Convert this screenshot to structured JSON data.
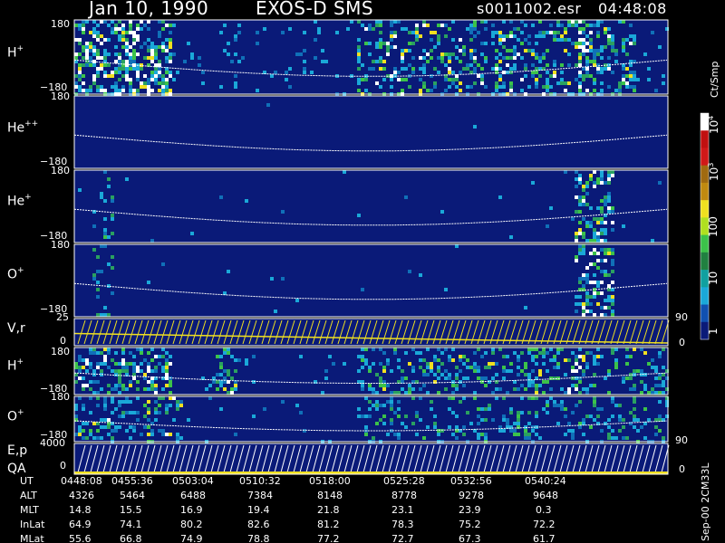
{
  "header": {
    "date": "Jan 10, 1990",
    "instrument": "EXOS-D SMS",
    "file": "s0011002.esr",
    "time": "04:48:08"
  },
  "panels": [
    {
      "label": "H",
      "charge": "+",
      "top_tick": "180",
      "bottom_tick": "−180"
    },
    {
      "label": "He",
      "charge": "++",
      "top_tick": "180",
      "bottom_tick": "−180"
    },
    {
      "label": "He",
      "charge": "+",
      "top_tick": "180",
      "bottom_tick": "−180"
    },
    {
      "label": "O",
      "charge": "+",
      "top_tick": "180",
      "bottom_tick": "−180"
    },
    {
      "label": "V,r",
      "charge": "",
      "top_tick": "25",
      "bottom_tick": "0",
      "right_top": "90",
      "right_bottom": "0"
    },
    {
      "label": "H",
      "charge": "+",
      "top_tick": "180",
      "bottom_tick": "−180"
    },
    {
      "label": "O",
      "charge": "+",
      "top_tick": "180",
      "bottom_tick": "−180"
    },
    {
      "label": "E,p",
      "label2": "QA",
      "charge": "",
      "top_tick": "4000",
      "bottom_tick": "0",
      "right_top": "90",
      "right_bottom": "0"
    }
  ],
  "colorbar": {
    "unit": "Ct/Smp",
    "ticks": [
      "10",
      "4",
      "10",
      "3",
      "100",
      "10",
      "1"
    ]
  },
  "footer_note": "Sep-00  2CM33L",
  "table": {
    "rows": [
      {
        "name": "UT",
        "values": [
          "0448:08",
          "0455:36",
          "0503:04",
          "0510:32",
          "0518:00",
          "0525:28",
          "0532:56",
          "0540:24"
        ]
      },
      {
        "name": "ALT",
        "values": [
          "4326",
          "5464",
          "6488",
          "7384",
          "8148",
          "8778",
          "9278",
          "9648"
        ]
      },
      {
        "name": "MLT",
        "values": [
          "14.8",
          "15.5",
          "16.9",
          "19.4",
          "21.8",
          "23.1",
          "23.9",
          "0.3"
        ]
      },
      {
        "name": "InLat",
        "values": [
          "64.9",
          "74.1",
          "80.2",
          "82.6",
          "81.2",
          "78.3",
          "75.2",
          "72.2"
        ]
      },
      {
        "name": "MLat",
        "values": [
          "55.6",
          "66.8",
          "74.9",
          "78.8",
          "77.2",
          "72.7",
          "67.3",
          "61.7"
        ]
      }
    ]
  },
  "chart_data": {
    "type": "heatmap",
    "x_axis": "UT",
    "x_ticks": [
      "0448:08",
      "0455:36",
      "0503:04",
      "0510:32",
      "0518:00",
      "0525:28",
      "0532:56",
      "0540:24"
    ],
    "color_scale": "log",
    "color_range": [
      1,
      10000
    ],
    "colors": {
      "background": "#0a1a78",
      "low": "#1aa8d8",
      "mid": "#3cc24a",
      "high": "#f0e020",
      "max": "#d01818",
      "sat": "#ffffff"
    }
  }
}
